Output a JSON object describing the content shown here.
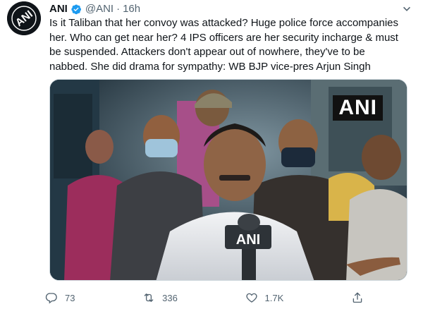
{
  "tweet": {
    "author_name": "ANI",
    "handle": "@ANI",
    "separator": "·",
    "timestamp": "16h",
    "text": "Is it Taliban that her convoy was attacked? Huge police force accompanies\nher. Who can get near her? 4 IPS officers are her security incharge & must\nbe suspended. Attackers don't appear out of nowhere, they've to be\nnabbed. She did drama for sympathy: WB BJP vice-pres Arjun Singh"
  },
  "avatar": {
    "logo_text": "ANI"
  },
  "media": {
    "watermark": "ANI",
    "mic_label": "ANI"
  },
  "actions": {
    "replies": "73",
    "retweets": "336",
    "likes": "1.7K"
  },
  "icons": {
    "more": "more-icon",
    "verified": "verified-badge-icon",
    "reply": "reply-icon",
    "retweet": "retweet-icon",
    "like": "like-icon",
    "share": "share-icon"
  },
  "colors": {
    "verified": "#1d9bf0",
    "secondary_text": "#536471",
    "primary_text": "#0f1419"
  }
}
